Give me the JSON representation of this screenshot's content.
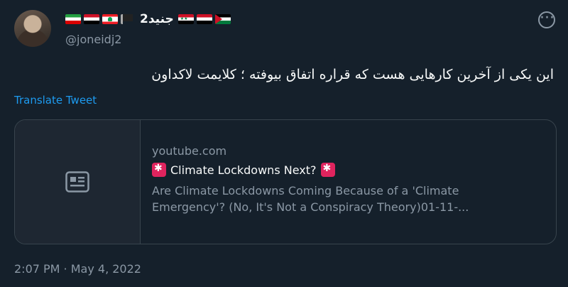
{
  "author": {
    "display_name": "جنید2",
    "handle": "@joneidj2",
    "flags_before": [
      "iran-flag-icon",
      "iraq-flag-icon",
      "lebanon-flag-icon",
      "black-flag-icon"
    ],
    "flags_after": [
      "syria-flag-icon",
      "yemen-flag-icon",
      "palestine-flag-icon"
    ]
  },
  "tweet": {
    "text": "این یکی از آخرین کارهایی هست که قراره اتفاق بیوفته ؛ کلایمت لاکداون",
    "translate_label": "Translate Tweet",
    "timestamp": "2:07 PM · May 4, 2022"
  },
  "card": {
    "domain": "youtube.com",
    "title": "Climate Lockdowns Next?",
    "description_line1": "Are Climate Lockdowns Coming Because of a 'Climate",
    "description_line2": "Emergency'? (No, It's Not a Conspiracy Theory)01-11-..."
  },
  "colors": {
    "background": "#15202b",
    "accent": "#1d9bf0",
    "secondary_text": "#8b98a5",
    "border": "#38444d"
  }
}
